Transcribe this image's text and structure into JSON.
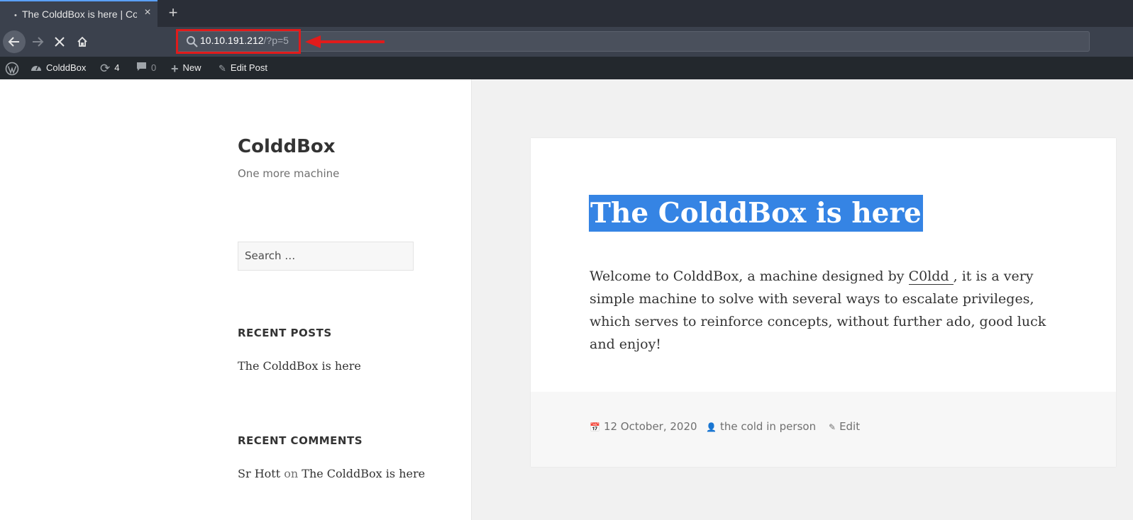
{
  "browser": {
    "tab_title": "The ColddBox is here | Co",
    "tab_close": "×",
    "new_tab": "+",
    "url_host": "10.10.191.212",
    "url_path": "/?p=5",
    "annotation_color": "#e11b1b"
  },
  "adminbar": {
    "site": "ColddBox",
    "updates": "4",
    "comments": "0",
    "new": "New",
    "edit_post": "Edit Post"
  },
  "sidebar": {
    "site_title": "ColddBox",
    "site_description": "One more machine",
    "search_placeholder": "Search …",
    "recent_posts_title": "RECENT POSTS",
    "recent_post": "The ColddBox is here",
    "recent_comments_title": "RECENT COMMENTS",
    "comment_author": "Sr Hott",
    "comment_on": "on",
    "comment_post": "The ColddBox is here"
  },
  "article": {
    "title": "The ColddBox is here",
    "content_before": "Welcome to ColddBox, a machine designed by ",
    "content_author": "C0ldd ",
    "content_after": ", it is a very simple machine to solve with several ways to escalate privileges, which serves to reinforce concepts, without further ado, good luck and enjoy!",
    "date": "12 October, 2020",
    "author": "the cold in person",
    "edit": "Edit",
    "selection_color": "#3584e4"
  }
}
